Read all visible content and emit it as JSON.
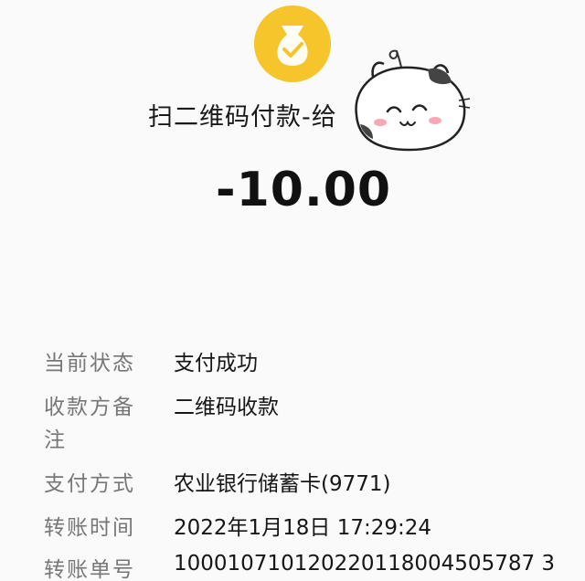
{
  "header": {
    "title": "扫二维码付款-给",
    "amount": "-10.00"
  },
  "icons": {
    "top": "money-bag-check-icon",
    "sticker": "cat-sticker"
  },
  "colors": {
    "coin": "#f5c52b",
    "label": "#777777",
    "value": "#161616"
  },
  "details": {
    "status_label": "当前状态",
    "status_value": "支付成功",
    "remark_label_line1": "收款方备",
    "remark_label_line2": "注",
    "remark_value": "二维码收款",
    "method_label": "支付方式",
    "method_value": "农业银行储蓄卡(9771)",
    "time_label": "转账时间",
    "time_value": "2022年1月18日 17:29:24",
    "order_label": "转账单号",
    "order_value": "100010710120220118004505787 3"
  }
}
